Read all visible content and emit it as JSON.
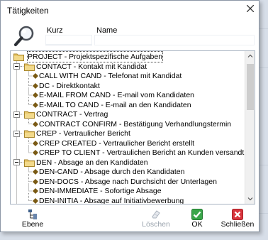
{
  "window": {
    "title": "Tätigkeiten"
  },
  "search": {
    "kurz_label": "Kurz",
    "name_label": "Name",
    "kurz_value": "",
    "name_value": ""
  },
  "tree": {
    "items": [
      {
        "level": 0,
        "expander": "",
        "icon": "folder",
        "text": "PROJECT - Projektspezifische Aufgaben",
        "selected": true
      },
      {
        "level": 1,
        "expander": "-",
        "icon": "folder",
        "text": "CONTACT - Kontakt mit Kandidat"
      },
      {
        "level": 2,
        "expander": "",
        "icon": "diamond",
        "text": "CALL WITH CAND - Telefonat mit Kandidat"
      },
      {
        "level": 2,
        "expander": "",
        "icon": "diamond",
        "text": "DC - Direktkontakt"
      },
      {
        "level": 2,
        "expander": "",
        "icon": "diamond",
        "text": "E-MAIL FROM CAND - E-mail vom Kandidaten"
      },
      {
        "level": 2,
        "expander": "",
        "icon": "diamond",
        "text": "E-MAIL TO CAND - E-mail an den Kandidaten"
      },
      {
        "level": 1,
        "expander": "-",
        "icon": "folder",
        "text": "CONTRACT - Vertrag"
      },
      {
        "level": 2,
        "expander": "",
        "icon": "diamond",
        "text": "CONTRACT CONFIRM - Bestätigung Verhandlungstermin"
      },
      {
        "level": 1,
        "expander": "-",
        "icon": "folder",
        "text": "CREP - Vertraulicher Bericht"
      },
      {
        "level": 2,
        "expander": "",
        "icon": "diamond",
        "text": "CREP CREATED - Vertraulicher Bericht erstellt"
      },
      {
        "level": 2,
        "expander": "",
        "icon": "diamond",
        "text": "CREP TO CLIENT - Vertraulichen Bericht an Kunden versandt"
      },
      {
        "level": 1,
        "expander": "-",
        "icon": "folder",
        "text": "DEN - Absage an den Kandidaten"
      },
      {
        "level": 2,
        "expander": "",
        "icon": "diamond",
        "text": "DEN-CAND - Absage durch den Kandidaten"
      },
      {
        "level": 2,
        "expander": "",
        "icon": "diamond",
        "text": "DEN-DOCS - Absage nach Durchsicht der Unterlagen"
      },
      {
        "level": 2,
        "expander": "",
        "icon": "diamond",
        "text": "DEN-IMMEDIATE - Sofortige Absage"
      },
      {
        "level": 2,
        "expander": "",
        "icon": "diamond",
        "text": "DEN-INITIA - Absage auf Initiativbewerbung"
      }
    ]
  },
  "toolbar": {
    "ebene_label": "Ebene",
    "loeschen_label": "Löschen",
    "ok_label": "OK",
    "schliessen_label": "Schließen"
  },
  "colors": {
    "folder": "#e8c76a",
    "diamond": "#7a5a14",
    "ok_green": "#3aa64a",
    "close_red": "#d9363e"
  }
}
